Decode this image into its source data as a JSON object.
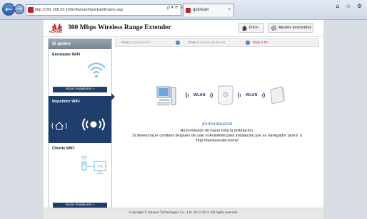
{
  "browser": {
    "address": "http://192.168.33.1/html/wizard/quicksetFrame.asp",
    "address_tools": "ρ ▾ ⟳ ×",
    "tab_title": "quickset",
    "window_buttons": "⌂ ☆ ⚙"
  },
  "header": {
    "logo_text": "HUAWEI",
    "title": "300 Mbps Wireless Range Extender",
    "home_label": "Inicio",
    "advanced_label": "Ajustes avanzados"
  },
  "sidebar": {
    "heading": "Si quiero",
    "items": [
      {
        "label": "Enrutador WiFi",
        "button": "Iniciar Instalación  »",
        "active": false
      },
      {
        "label": "Repetidor WiFi",
        "active": true
      },
      {
        "label": "Cliente WiFi",
        "button": "Iniciar Instalación  »",
        "active": false
      }
    ],
    "pc_label": "PC"
  },
  "steps": [
    {
      "num": "Paso 1",
      "name": "Introducción",
      "state": "done"
    },
    {
      "num": "Paso 2",
      "name": "Ajustes de WLAN",
      "state": "done"
    },
    {
      "num": "Paso 3",
      "name": "Fin",
      "state": "current"
    }
  ],
  "diagram": {
    "wlan_label_1": "WLAN",
    "wlan_label_2": "WLAN"
  },
  "result": {
    "heading": "¡Enhorabuena!",
    "line1": "Ha terminado de hacer toda la instalación.",
    "line2": "Si desea hacer cambios después de usar el Asistente para instalación,use su navegador para ir a",
    "line3": "\"http://mediarouter.home\""
  },
  "footer": {
    "copyright": "Copyright © Huawei Technologies Co., Ltd. 2012-2014. All rights reserved."
  },
  "colors": {
    "brand_red": "#c0202a",
    "navy": "#1f3e6b",
    "link_blue": "#3c6fb5"
  }
}
